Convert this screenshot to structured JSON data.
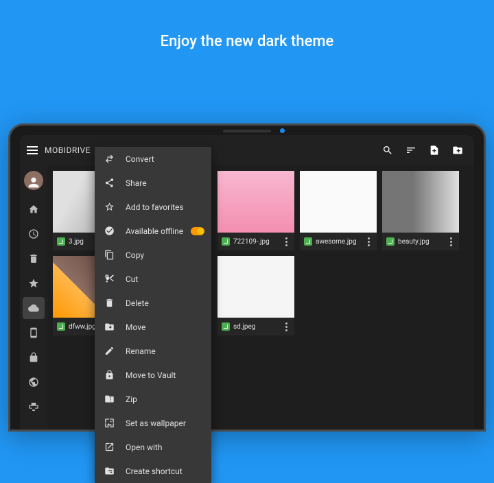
{
  "promo": {
    "title": "Enjoy the new dark theme"
  },
  "app": {
    "title": "MOBIDRIVE"
  },
  "rail": {
    "items": [
      {
        "name": "home"
      },
      {
        "name": "recent"
      },
      {
        "name": "trash"
      },
      {
        "name": "favorites"
      },
      {
        "name": "cloud"
      },
      {
        "name": "device"
      },
      {
        "name": "secure"
      },
      {
        "name": "web"
      },
      {
        "name": "network"
      }
    ]
  },
  "files": [
    {
      "name": "3.jpg"
    },
    {
      "name": "dfww.jpg"
    },
    {
      "name": "722109-.jpg"
    },
    {
      "name": "sd.jpeg"
    },
    {
      "name": "awesome.jpg"
    },
    {
      "name": "beauty.jpg"
    }
  ],
  "menu": {
    "convert": "Convert",
    "share": "Share",
    "favorite": "Add to favorites",
    "offline": "Available offline",
    "copy": "Copy",
    "cut": "Cut",
    "delete": "Delete",
    "move": "Move",
    "rename": "Rename",
    "vault": "Move to Vault",
    "zip": "Zip",
    "wallpaper": "Set as wallpaper",
    "openwith": "Open with",
    "shortcut": "Create shortcut",
    "offline_on": true
  }
}
